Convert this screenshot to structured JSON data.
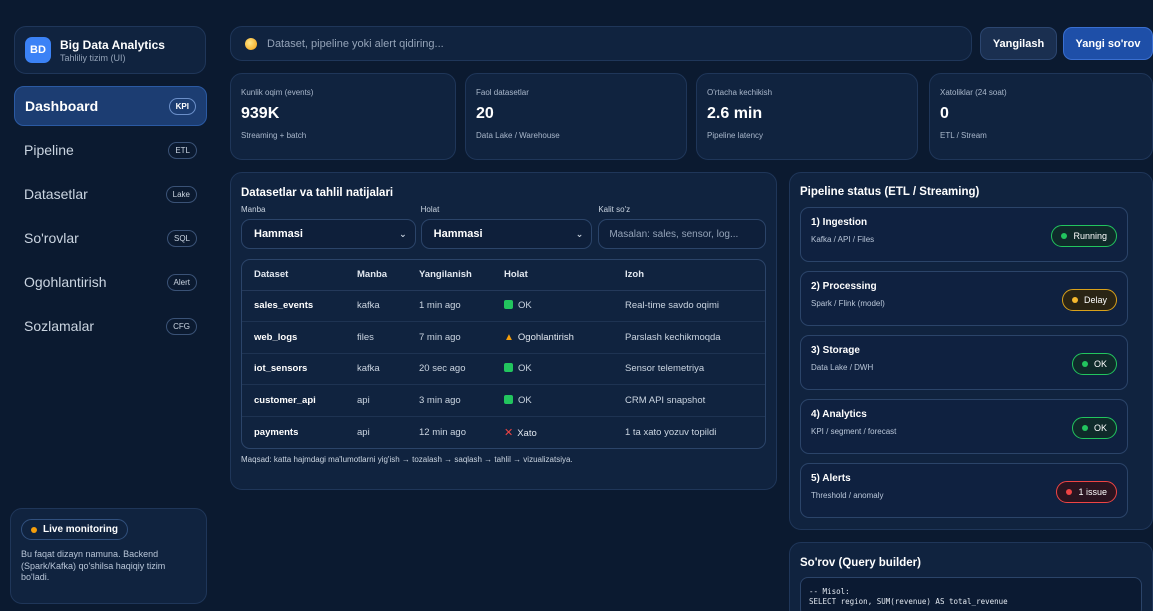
{
  "brand": {
    "logo": "BD",
    "title": "Big Data Analytics",
    "subtitle": "Tahliliy tizim (UI)"
  },
  "nav": [
    {
      "label": "Dashboard",
      "badge": "KPI",
      "active": true
    },
    {
      "label": "Pipeline",
      "badge": "ETL"
    },
    {
      "label": "Datasetlar",
      "badge": "Lake"
    },
    {
      "label": "So'rovlar",
      "badge": "SQL"
    },
    {
      "label": "Ogohlantirish",
      "badge": "Alert"
    },
    {
      "label": "Sozlamalar",
      "badge": "CFG"
    }
  ],
  "live": {
    "label": "Live monitoring",
    "dot_color": "#f59e0b",
    "text": "Bu faqat dizayn namuna. Backend (Spark/Kafka) qo'shilsa haqiqiy tizim bo'ladi."
  },
  "search": {
    "placeholder": "Dataset, pipeline yoki alert qidiring...",
    "icon": "search-icon"
  },
  "buttons": {
    "refresh": "Yangilash",
    "new_query": "Yangi so'rov"
  },
  "kpis": [
    {
      "label": "Kunlik oqim (events)",
      "value": "939K",
      "sub": "Streaming + batch"
    },
    {
      "label": "Faol datasetlar",
      "value": "20",
      "sub": "Data Lake / Warehouse"
    },
    {
      "label": "O'rtacha kechikish",
      "value": "2.6 min",
      "sub": "Pipeline latency"
    },
    {
      "label": "Xatoliklar (24 soat)",
      "value": "0",
      "sub": "ETL / Stream"
    }
  ],
  "datasets": {
    "title": "Datasetlar va tahlil natijalari",
    "filters": {
      "source_label": "Manba",
      "source_value": "Hammasi",
      "status_label": "Holat",
      "status_value": "Hammasi",
      "keyword_label": "Kalit so'z",
      "keyword_placeholder": "Masalan: sales, sensor, log..."
    },
    "columns": [
      "Dataset",
      "Manba",
      "Yangilanish",
      "Holat",
      "Izoh"
    ],
    "rows": [
      {
        "dataset": "sales_events",
        "source": "kafka",
        "updated": "1 min ago",
        "status": "OK",
        "status_type": "ok",
        "note": "Real-time savdo oqimi"
      },
      {
        "dataset": "web_logs",
        "source": "files",
        "updated": "7 min ago",
        "status": "Ogohlantirish",
        "status_type": "warn",
        "note": "Parslash kechikmoqda"
      },
      {
        "dataset": "iot_sensors",
        "source": "kafka",
        "updated": "20 sec ago",
        "status": "OK",
        "status_type": "ok",
        "note": "Sensor telemetriya"
      },
      {
        "dataset": "customer_api",
        "source": "api",
        "updated": "3 min ago",
        "status": "OK",
        "status_type": "ok",
        "note": "CRM API snapshot"
      },
      {
        "dataset": "payments",
        "source": "api",
        "updated": "12 min ago",
        "status": "Xato",
        "status_type": "err",
        "note": "1 ta xato yozuv topildi"
      }
    ],
    "goal": "Maqsad: katta hajmdagi ma'lumotlarni yig'ish → tozalash → saqlash → tahlil → vizualizatsiya."
  },
  "pipeline": {
    "title": "Pipeline status (ETL / Streaming)",
    "stages": [
      {
        "title": "1) Ingestion",
        "sub": "Kafka / API / Files",
        "status": "Running",
        "color": "#22c55e"
      },
      {
        "title": "2) Processing",
        "sub": "Spark / Flink (model)",
        "status": "Delay",
        "color": "#f5b82e"
      },
      {
        "title": "3) Storage",
        "sub": "Data Lake / DWH",
        "status": "OK",
        "color": "#22c55e"
      },
      {
        "title": "4) Analytics",
        "sub": "KPI / segment / forecast",
        "status": "OK",
        "color": "#22c55e"
      },
      {
        "title": "5) Alerts",
        "sub": "Threshold / anomaly",
        "status": "1 issue",
        "color": "#ef4444"
      }
    ]
  },
  "query": {
    "title": "So'rov (Query builder)",
    "code_line1": "-- Misol:",
    "code_line2": "SELECT region, SUM(revenue) AS total_revenue"
  }
}
